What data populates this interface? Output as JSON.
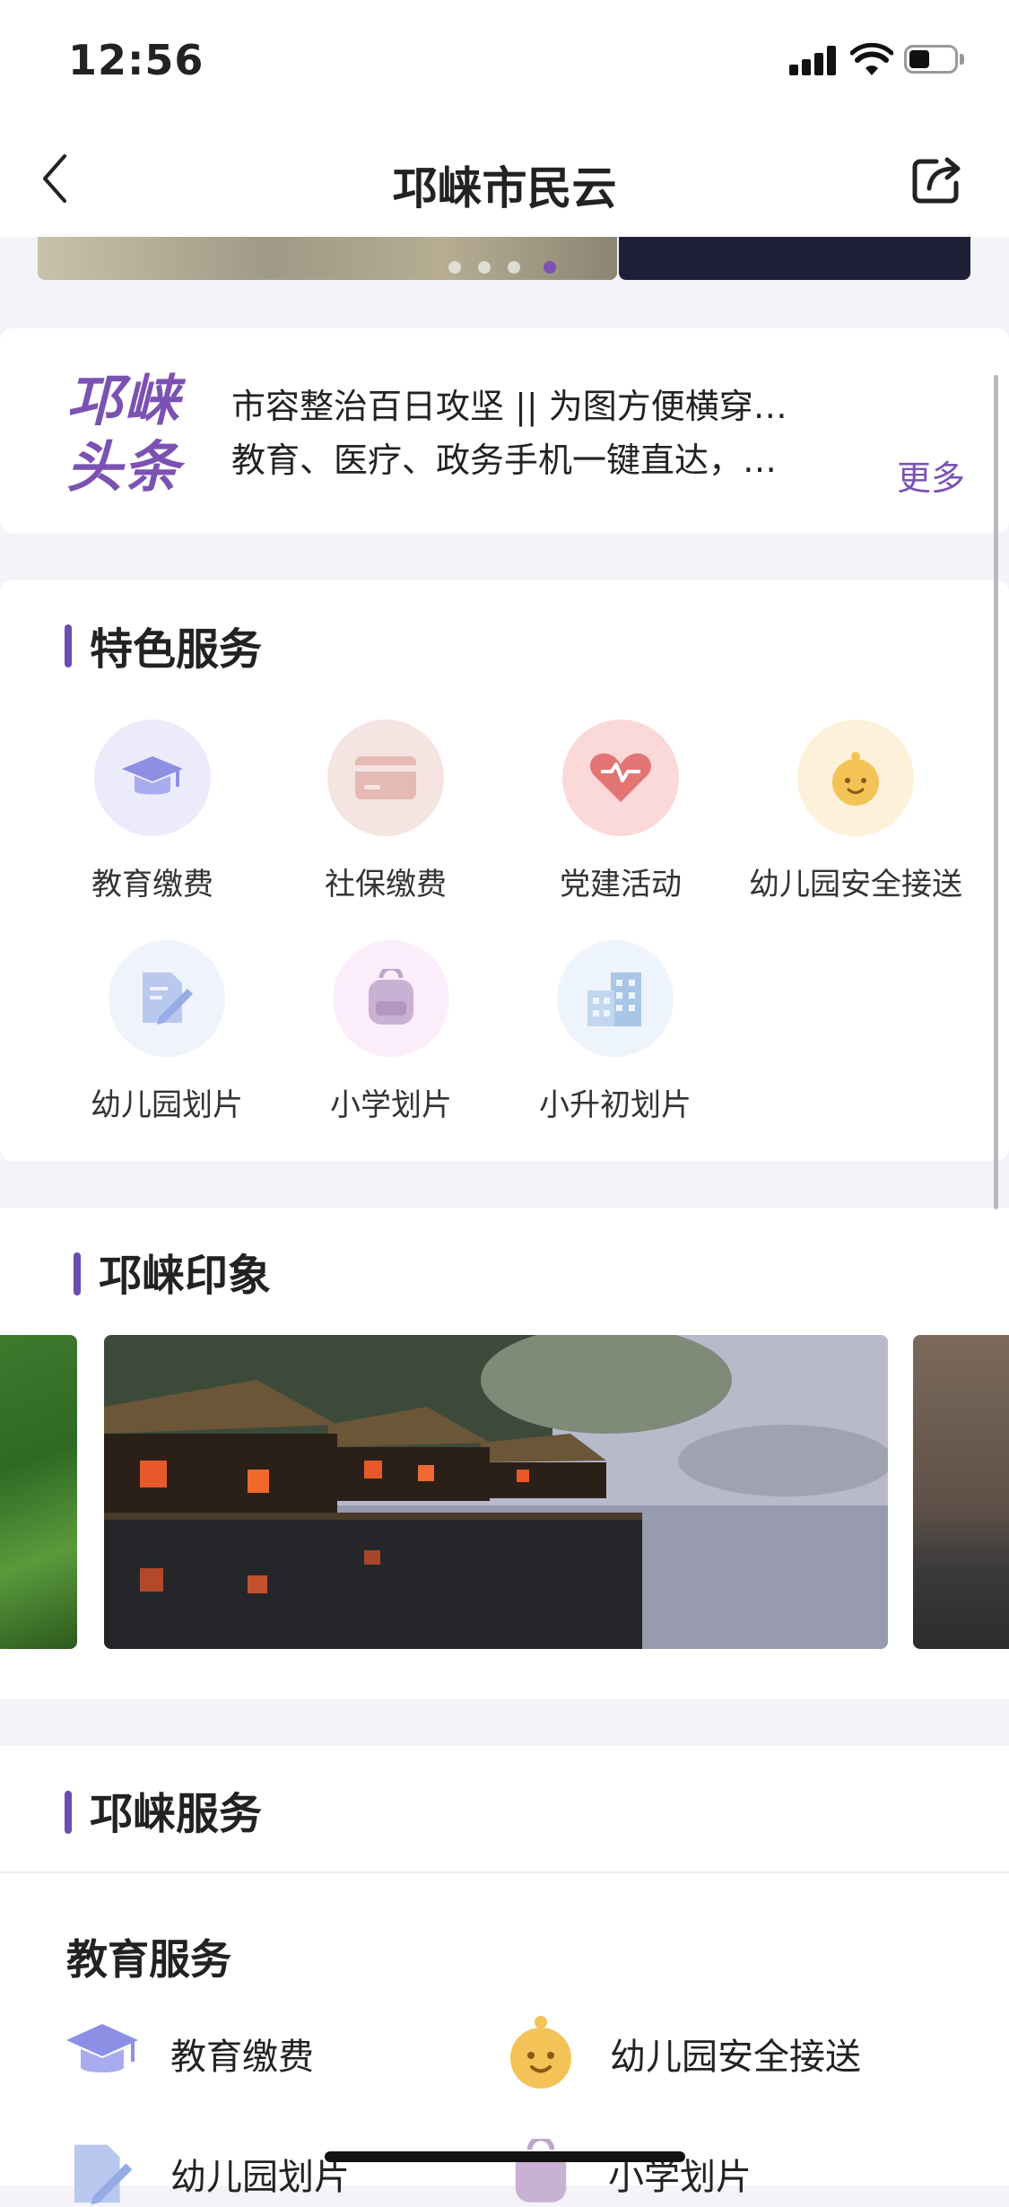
{
  "status_bar": {
    "time": "12:56"
  },
  "nav": {
    "title": "邛崃市民云"
  },
  "banner": {
    "dots_count": 4,
    "active_dot": 3
  },
  "headlines": {
    "logo_line1": "邛崃",
    "logo_line2": "头条",
    "items": [
      "市容整治百日攻坚 || 为图方便横穿…",
      "教育、医疗、政务手机一键直达，…"
    ],
    "more": "更多"
  },
  "featured": {
    "title": "特色服务",
    "items": [
      {
        "label": "教育缴费",
        "icon": "graduation-cap-icon"
      },
      {
        "label": "社保缴费",
        "icon": "card-icon"
      },
      {
        "label": "党建活动",
        "icon": "heart-icon"
      },
      {
        "label": "幼儿园安全接送",
        "icon": "baby-face-icon"
      },
      {
        "label": "幼儿园划片",
        "icon": "pencil-document-icon"
      },
      {
        "label": "小学划片",
        "icon": "backpack-icon"
      },
      {
        "label": "小升初划片",
        "icon": "buildings-icon"
      }
    ]
  },
  "impression": {
    "title": "邛崃印象"
  },
  "city_services": {
    "title": "邛崃服务",
    "education": {
      "title": "教育服务",
      "items": [
        "教育缴费",
        "幼儿园安全接送",
        "幼儿园划片",
        "小学划片"
      ]
    }
  },
  "colors": {
    "accent": "#7b52b3",
    "section_bar": "#6d4bb0"
  }
}
